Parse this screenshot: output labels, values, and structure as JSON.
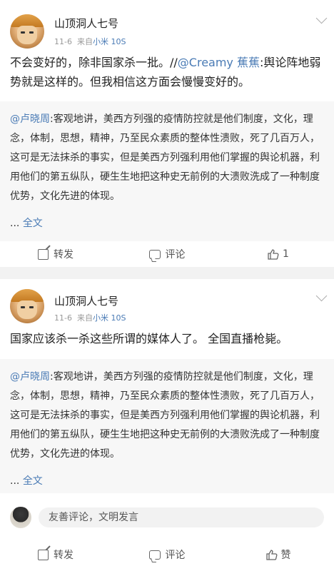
{
  "posts": [
    {
      "username": "山顶洞人七号",
      "date": "11-6",
      "from_label": "来自",
      "device": "小米 10S",
      "text_main": "不会变好的，除非国家杀一批。//",
      "mention": "@Creamy 蕉蕉",
      "text_after": ":舆论阵地弱势就是这样的。但我相信这方面会慢慢变好的。",
      "quote_mention": "@卢晓周",
      "quote_text": ":客观地讲，美西方列强的疫情防控就是他们制度，文化，理念，体制，思想，精神，乃至民众素质的整体性溃败，死了几百万人，这可是无法抹杀的事实，但是美西方列强利用他们掌握的舆论机器，利用他们的第五纵队，硬生生地把这种史无前例的大溃败洗成了一种制度优势，文化先进的体现。",
      "quote_more_prefix": "... ",
      "quote_more_link": "全文",
      "actions": {
        "share": "转发",
        "comment": "评论",
        "like": "1"
      }
    },
    {
      "username": "山顶洞人七号",
      "date": "11-6",
      "from_label": "来自",
      "device": "小米 10S",
      "text_main": "国家应该杀一杀这些所谓的媒体人了。 全国直播枪毙。",
      "quote_mention": "@卢晓周",
      "quote_text": ":客观地讲，美西方列强的疫情防控就是他们制度，文化，理念，体制，思想，精神，乃至民众素质的整体性溃败，死了几百万人，这可是无法抹杀的事实，但是美西方列强利用他们掌握的舆论机器，利用他们的第五纵队，硬生生地把这种史无前例的大溃败洗成了一种制度优势，文化先进的体现。",
      "quote_more_prefix": "... ",
      "quote_more_link": "全文",
      "comment_placeholder": "友善评论，文明发言",
      "actions": {
        "share": "转发",
        "comment": "评论",
        "like": "赞"
      }
    }
  ],
  "colors": {
    "link": "#4a7bb5",
    "background": "#f2f2f2",
    "quote_bg": "#f7f7f7"
  },
  "icons": [
    "share-icon",
    "comment-icon",
    "like-icon",
    "chevron-down-icon"
  ]
}
